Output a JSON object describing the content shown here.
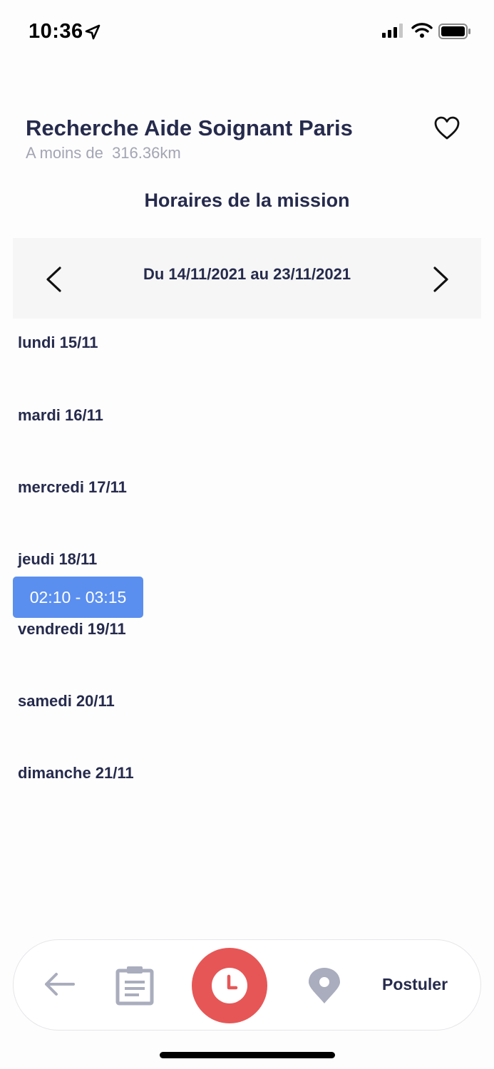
{
  "status_bar": {
    "time": "10:36"
  },
  "header": {
    "title": "Recherche Aide Soignant Paris",
    "subtitle": "A moins de  316.36km",
    "favorite_icon": "heart-outline-icon"
  },
  "schedule": {
    "heading": "Horaires de la mission",
    "range_label": "Du 14/11/2021 au 23/11/2021",
    "days": [
      {
        "label": "lundi 15/11"
      },
      {
        "label": "mardi 16/11"
      },
      {
        "label": "mercredi 17/11"
      },
      {
        "label": "jeudi 18/11"
      },
      {
        "label": "vendredi 19/11"
      },
      {
        "label": "samedi 20/11"
      },
      {
        "label": "dimanche 21/11"
      }
    ],
    "slots": [
      {
        "day": "jeudi 18/11",
        "label": "02:10 - 03:15"
      }
    ]
  },
  "bottom_nav": {
    "items": [
      "back-arrow-icon",
      "clipboard-icon",
      "clock-icon",
      "location-pin-icon"
    ],
    "apply_label": "Postuler"
  },
  "colors": {
    "text_primary": "#262b4d",
    "text_secondary": "#a3a5b4",
    "slot_blue": "#5b8fef",
    "active_red": "#e75656",
    "inactive_icon": "#a9adbd"
  }
}
